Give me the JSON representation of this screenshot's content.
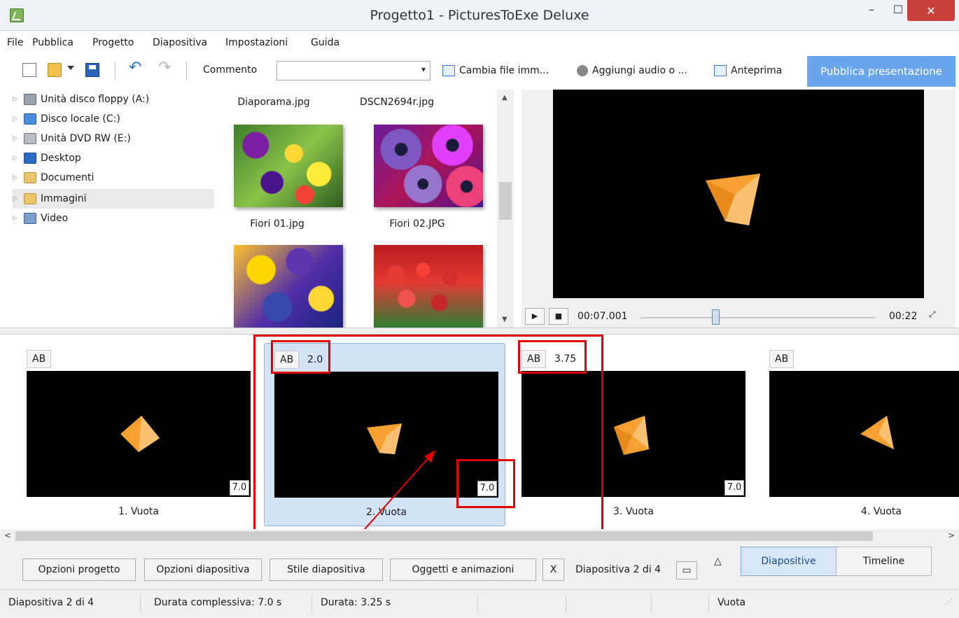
{
  "window": {
    "title": "Progetto1 - PicturesToExe Deluxe",
    "minimize": "–",
    "maximize": "☐",
    "close": "✕"
  },
  "menu": [
    "File",
    "Pubblica",
    "Progetto",
    "Diapositiva",
    "Impostazioni",
    "Guida"
  ],
  "toolbar": {
    "comment_label": "Commento",
    "comment_value": "",
    "change_file_label": "Cambia file imm...",
    "add_audio_label": "Aggiungi audio o ...",
    "preview_label": "Anteprima",
    "publish_label": "Pubblica presentazione"
  },
  "tree": [
    {
      "label": "Unità disco floppy (A:)",
      "icon": "floppy-icon"
    },
    {
      "label": "Disco locale (C:)",
      "icon": "disk-icon"
    },
    {
      "label": "Unità DVD RW (E:)",
      "icon": "dvd-icon"
    },
    {
      "label": "Desktop",
      "icon": "desktop-icon"
    },
    {
      "label": "Documenti",
      "icon": "folder-icon"
    },
    {
      "label": "Immagini",
      "icon": "folder-icon",
      "selected": true
    },
    {
      "label": "Video",
      "icon": "video-icon"
    }
  ],
  "thumbnails": {
    "top_labels": [
      "Diaporama.jpg",
      "DSCN2694r.jpg"
    ],
    "row1": [
      "Fiori 01.jpg",
      "Fiori 02.JPG"
    ]
  },
  "preview": {
    "current_time": "00:07.001",
    "total_time": "00:22",
    "position_fraction": 0.32,
    "play": "▶",
    "stop": "■"
  },
  "slides": [
    {
      "ab": "AB",
      "transition": "",
      "duration": "7.0",
      "caption": "1. Vuota"
    },
    {
      "ab": "AB",
      "transition": "2.0",
      "duration": "7.0",
      "caption": "2. Vuota",
      "selected": true
    },
    {
      "ab": "AB",
      "transition": "3.75",
      "duration": "7.0",
      "caption": "3. Vuota"
    },
    {
      "ab": "AB",
      "transition": "",
      "duration": "",
      "caption": "4. Vuota"
    }
  ],
  "bottom": {
    "project_options": "Opzioni progetto",
    "slide_options": "Opzioni diapositiva",
    "slide_style": "Stile diapositiva",
    "objects_animations": "Oggetti e animazioni",
    "x_button": "X",
    "slide_counter": "Diapositiva 2 di 4",
    "collapse_glyph": "△",
    "tab_slides": "Diapositive",
    "tab_timeline": "Timeline"
  },
  "status": {
    "slide": "Diapositiva 2 di 4",
    "total_duration": "Durata complessiva: 7.0 s",
    "duration": "Durata: 3.25 s",
    "name": "Vuota"
  },
  "colors": {
    "annotation_red": "#e00000",
    "publish_blue": "#6aa5ec",
    "selected_slide": "#d2e3f6",
    "pyramid_orange": "#f5a030"
  }
}
